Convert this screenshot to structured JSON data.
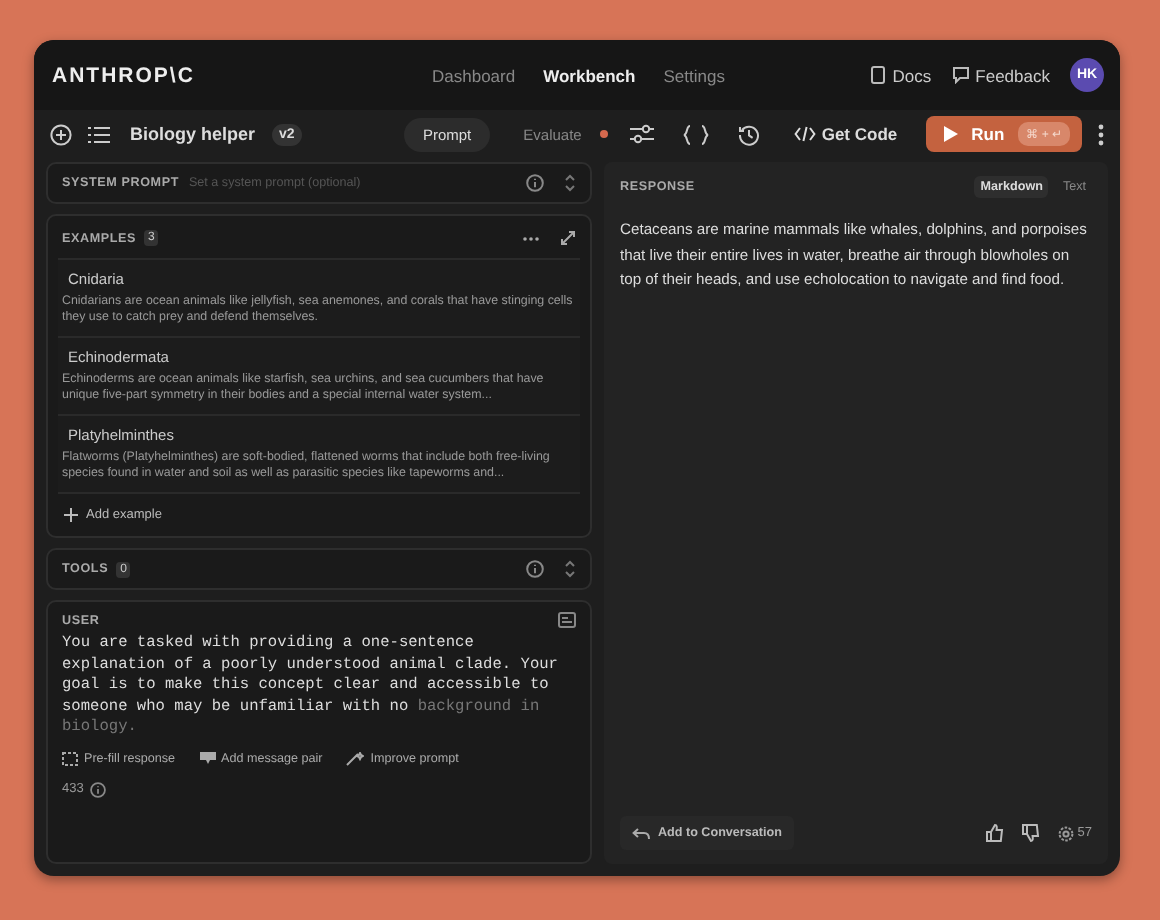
{
  "brand": "ANTHROP\\C",
  "nav": [
    {
      "label": "Dashboard",
      "selected": false
    },
    {
      "label": "Workbench",
      "selected": true
    },
    {
      "label": "Settings",
      "selected": false
    }
  ],
  "header_links": [
    "Docs",
    "Feedback"
  ],
  "avatar": "HK",
  "toolbar": {
    "title": "Biology helper",
    "version": "v2",
    "modes": [
      {
        "label": "Prompt",
        "selected": true
      },
      {
        "label": "Evaluate",
        "selected": false
      }
    ],
    "get_code": "Get Code",
    "run": "Run",
    "run_shortcut": "⌘ + ↵"
  },
  "system_prompt": {
    "label": "SYSTEM PROMPT",
    "placeholder": "Set a system prompt (optional)"
  },
  "examples": {
    "label": "EXAMPLES",
    "count": "3",
    "add": "Add example",
    "items": [
      {
        "title": "Cnidaria",
        "text": "Cnidarians are ocean animals like jellyfish, sea anemones, and corals that have stinging cells they use to catch prey and defend themselves."
      },
      {
        "title": "Echinodermata",
        "text": "Echinoderms are ocean animals like starfish, sea urchins, and sea cucumbers that have unique five-part symmetry in their bodies and a special internal water system..."
      },
      {
        "title": "Platyhelminthes",
        "text": "Flatworms (Platyhelminthes) are soft-bodied, flattened worms that include both free-living species found in water and soil as well as parasitic species like tapeworms and..."
      }
    ]
  },
  "tools": {
    "label": "TOOLS",
    "count": "0"
  },
  "user": {
    "label": "USER",
    "text": "You are tasked with providing a one-sentence explanation of a poorly understood animal clade. Your goal is to make this concept clear and accessible to someone who may be unfamiliar with no",
    "text_faded": "background in biology.",
    "actions": [
      "Pre-fill response",
      "Add message pair",
      "Improve prompt"
    ],
    "token_count": "433"
  },
  "response": {
    "label": "RESPONSE",
    "formats": [
      {
        "label": "Markdown",
        "selected": true
      },
      {
        "label": "Text",
        "selected": false
      }
    ],
    "text": "Cetaceans are marine mammals like whales, dolphins, and porpoises that live their entire lives in water, breathe air through blowholes on top of their heads, and use echolocation to navigate and find food.",
    "add": "Add to Conversation",
    "token_count": "57"
  }
}
